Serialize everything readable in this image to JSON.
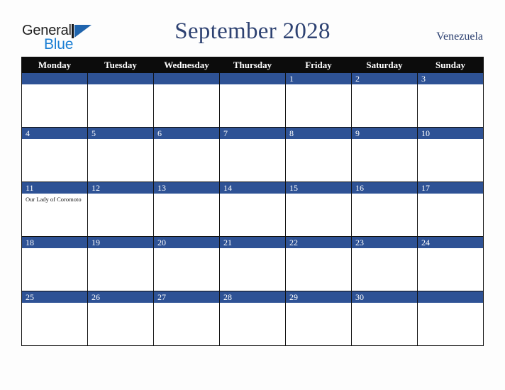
{
  "brand": {
    "name_part1": "General",
    "name_part2": "Blue",
    "mark_icon": "triangle-flag-icon"
  },
  "header": {
    "title": "September 2028",
    "region": "Venezuela"
  },
  "calendar": {
    "weekday_headers": [
      "Monday",
      "Tuesday",
      "Wednesday",
      "Thursday",
      "Friday",
      "Saturday",
      "Sunday"
    ],
    "weeks": [
      [
        {
          "day": "",
          "events": []
        },
        {
          "day": "",
          "events": []
        },
        {
          "day": "",
          "events": []
        },
        {
          "day": "",
          "events": []
        },
        {
          "day": "1",
          "events": []
        },
        {
          "day": "2",
          "events": []
        },
        {
          "day": "3",
          "events": []
        }
      ],
      [
        {
          "day": "4",
          "events": []
        },
        {
          "day": "5",
          "events": []
        },
        {
          "day": "6",
          "events": []
        },
        {
          "day": "7",
          "events": []
        },
        {
          "day": "8",
          "events": []
        },
        {
          "day": "9",
          "events": []
        },
        {
          "day": "10",
          "events": []
        }
      ],
      [
        {
          "day": "11",
          "events": [
            "Our Lady of Coromoto"
          ]
        },
        {
          "day": "12",
          "events": []
        },
        {
          "day": "13",
          "events": []
        },
        {
          "day": "14",
          "events": []
        },
        {
          "day": "15",
          "events": []
        },
        {
          "day": "16",
          "events": []
        },
        {
          "day": "17",
          "events": []
        }
      ],
      [
        {
          "day": "18",
          "events": []
        },
        {
          "day": "19",
          "events": []
        },
        {
          "day": "20",
          "events": []
        },
        {
          "day": "21",
          "events": []
        },
        {
          "day": "22",
          "events": []
        },
        {
          "day": "23",
          "events": []
        },
        {
          "day": "24",
          "events": []
        }
      ],
      [
        {
          "day": "25",
          "events": []
        },
        {
          "day": "26",
          "events": []
        },
        {
          "day": "27",
          "events": []
        },
        {
          "day": "28",
          "events": []
        },
        {
          "day": "29",
          "events": []
        },
        {
          "day": "30",
          "events": []
        },
        {
          "day": "",
          "events": []
        }
      ]
    ]
  },
  "colors": {
    "day_band": "#2e5295",
    "header_band": "#0c0c0c",
    "title_text": "#2e4272",
    "brand_blue": "#1c7fd4",
    "page_background": "#fdfdfd"
  }
}
